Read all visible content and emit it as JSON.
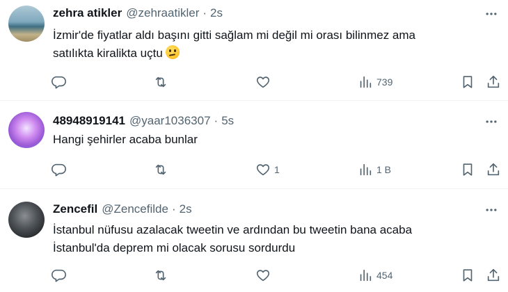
{
  "tweets": [
    {
      "name": "zehra atikler",
      "handle": "@zehraatikler",
      "time": "2s",
      "lines": [
        "İzmir'de fiyatlar aldı başını gitti sağlam mi değil mi orası bilinmez ama",
        "satılıkta kiralikta uçtu"
      ],
      "emoji": "thinking-face-emoji",
      "reply_count": "",
      "retweet_count": "",
      "like_count": "",
      "view_count": "739"
    },
    {
      "name": "48948919141",
      "handle": "@yaar1036307",
      "time": "5s",
      "lines": [
        "Hangi şehirler acaba bunlar"
      ],
      "reply_count": "",
      "retweet_count": "",
      "like_count": "1",
      "view_count": "1 B"
    },
    {
      "name": "Zencefil",
      "handle": "@Zencefilde",
      "time": "2s",
      "lines": [
        "İstanbul nüfusu azalacak tweetin ve ardından bu tweetin bana acaba",
        "İstanbul'da deprem mi olacak sorusu sordurdu"
      ],
      "reply_count": "",
      "retweet_count": "",
      "like_count": "",
      "view_count": "454"
    }
  ],
  "separator": "·",
  "icons": {
    "reply": "reply-icon",
    "retweet": "retweet-icon",
    "like": "heart-icon",
    "views": "views-icon",
    "bookmark": "bookmark-icon",
    "share": "share-icon",
    "more": "more-icon"
  },
  "colors": {
    "text": "#0f1419",
    "secondary": "#536471",
    "divider": "#eff3f4"
  }
}
